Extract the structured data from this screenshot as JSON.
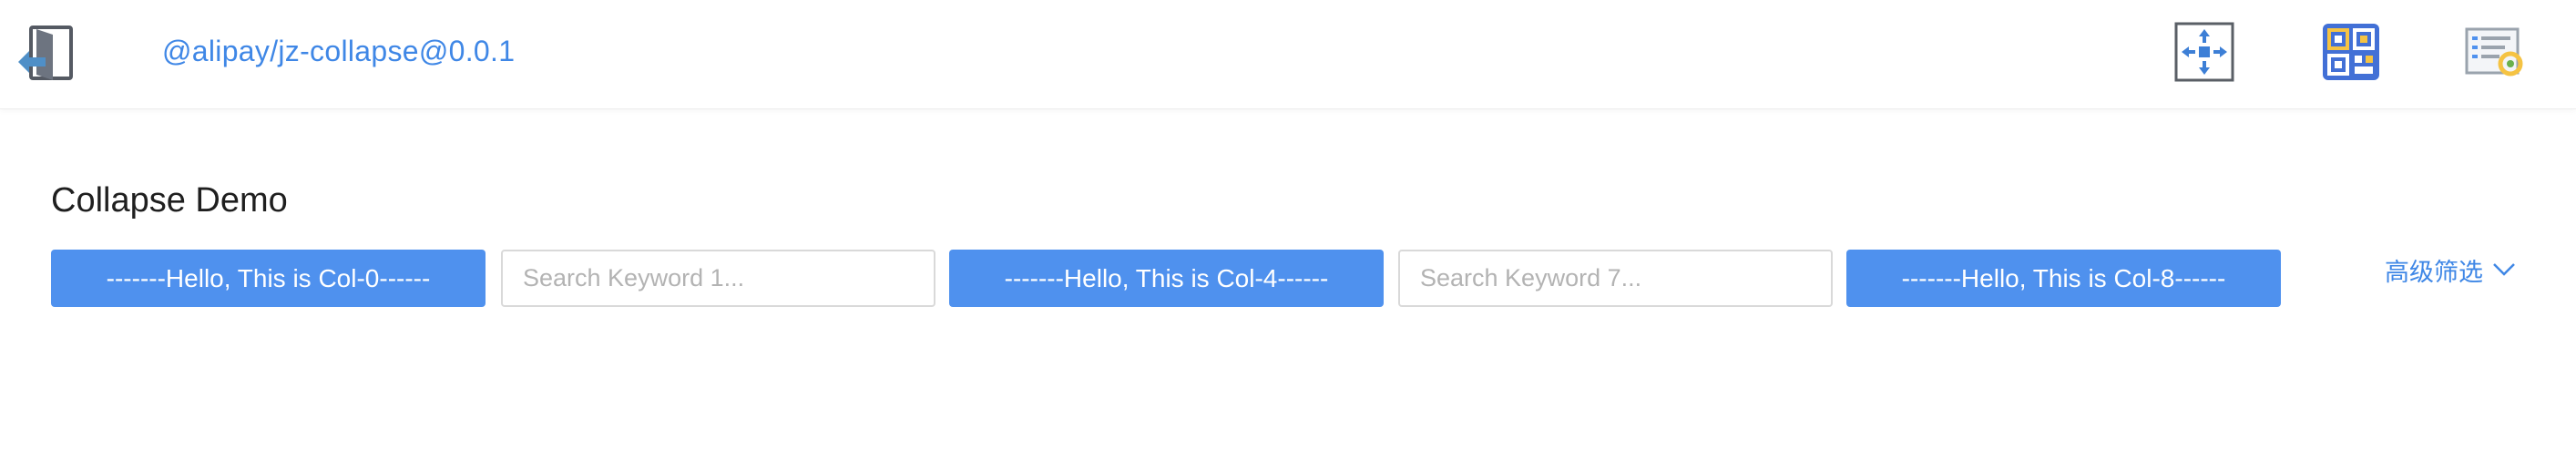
{
  "header": {
    "package_title": "@alipay/jz-collapse@0.0.1",
    "icons": [
      "exit-icon",
      "expand-arrows-icon",
      "qr-code-icon",
      "list-settings-icon"
    ]
  },
  "demo": {
    "title": "Collapse Demo",
    "button_col0": "-------Hello, This is Col-0------",
    "search1_placeholder": "Search Keyword 1...",
    "button_col4": "-------Hello, This is Col-4------",
    "search7_placeholder": "Search Keyword 7...",
    "button_col8": "-------Hello, This is Col-8------",
    "advanced_filter_label": "高级筛选"
  },
  "colors": {
    "accent": "#4f91ee",
    "link": "#3f87e6",
    "icon_blue": "#4270d6",
    "icon_yellow": "#f5c343"
  }
}
